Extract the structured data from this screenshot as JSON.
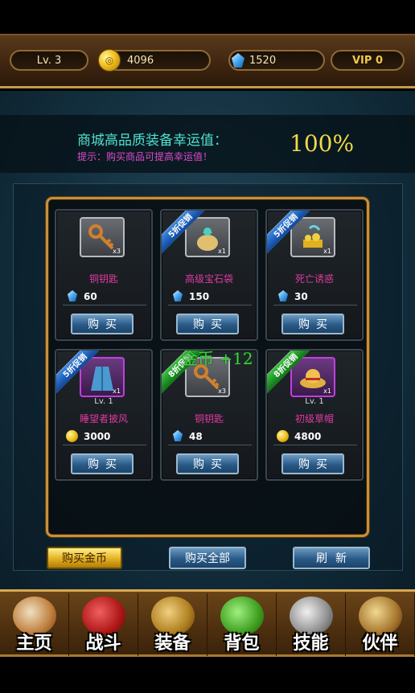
{
  "status": {
    "level": "Lv. 3",
    "gold": "4096",
    "gems": "1520",
    "vip": "VIP 0"
  },
  "luck": {
    "title": "商城高品质装备幸运值：",
    "hint": "提示：购买商品可提高幸运值！",
    "value": "100%"
  },
  "items": [
    {
      "name": "铜钥匙",
      "qty": "x3",
      "level": "",
      "price": "60",
      "currency": "gem",
      "ribbon": "",
      "icon": "key-icon",
      "rarity": "gray"
    },
    {
      "name": "高级宝石袋",
      "qty": "x1",
      "level": "",
      "price": "150",
      "currency": "gem",
      "ribbon": "5折促销",
      "icon": "gem-bag-icon",
      "rarity": "gray"
    },
    {
      "name": "死亡诱惑",
      "qty": "x1",
      "level": "",
      "price": "30",
      "currency": "gem",
      "ribbon": "5折促销",
      "icon": "treasure-icon",
      "rarity": "gray"
    },
    {
      "name": "睡望者披风",
      "qty": "x1",
      "level": "Lv. 1",
      "price": "3000",
      "currency": "gold",
      "ribbon": "5折促销",
      "icon": "cloak-icon",
      "rarity": "purple"
    },
    {
      "name": "铜钥匙",
      "qty": "x3",
      "level": "",
      "price": "48",
      "currency": "gem",
      "ribbon": "8折促销",
      "icon": "key-icon",
      "rarity": "gray"
    },
    {
      "name": "初级草帽",
      "qty": "x1",
      "level": "Lv. 1",
      "price": "4800",
      "currency": "gold",
      "ribbon": "8折促销",
      "icon": "straw-hat-icon",
      "rarity": "purple"
    }
  ],
  "buy_label": "购买",
  "float_text": "金币 +12",
  "actions": {
    "buy_gold": "购买金币",
    "buy_all": "购买全部",
    "refresh": "刷新"
  },
  "nav": [
    {
      "label": "主页",
      "icon": "skull-hat-icon"
    },
    {
      "label": "战斗",
      "icon": "pirate-flag-icon"
    },
    {
      "label": "装备",
      "icon": "armor-icon"
    },
    {
      "label": "背包",
      "icon": "bag-icon"
    },
    {
      "label": "技能",
      "icon": "hammer-icon"
    },
    {
      "label": "伙伴",
      "icon": "card-icon"
    }
  ],
  "colors": {
    "accent_gold": "#c8903a",
    "luck_title": "#4fe0d0",
    "luck_hint": "#e04ad0",
    "luck_value": "#f2d84a",
    "item_name": "#e03aa0",
    "ribbon_blue": "#1048a0",
    "ribbon_green": "#107818"
  }
}
